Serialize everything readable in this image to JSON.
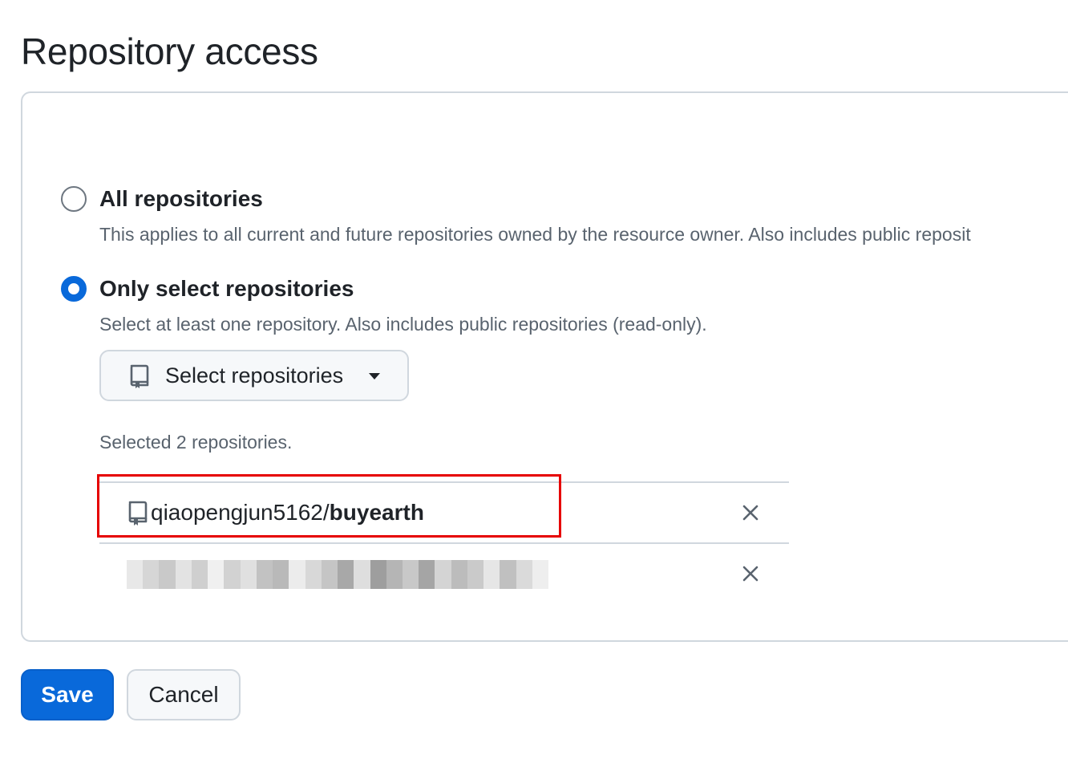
{
  "page": {
    "title": "Repository access"
  },
  "options": {
    "all": {
      "title": "All repositories",
      "description": "This applies to all current and future repositories owned by the resource owner. Also includes public reposit",
      "selected": false
    },
    "select": {
      "title": "Only select repositories",
      "description": "Select at least one repository. Also includes public repositories (read-only).",
      "selected": true
    }
  },
  "repo_picker": {
    "button_label": "Select repositories",
    "icon": "repo-icon"
  },
  "selected_summary": "Selected 2 repositories.",
  "repositories": [
    {
      "owner": "qiaopengjun5162/",
      "name": "buyearth",
      "icon": "repo-icon",
      "remove_icon": "x-icon"
    },
    {
      "owner": "",
      "name": "",
      "redacted": true,
      "remove_icon": "x-icon"
    }
  ],
  "actions": {
    "save_label": "Save",
    "cancel_label": "Cancel"
  },
  "colors": {
    "accent": "#0969da",
    "highlight": "#e60000",
    "border": "#d0d7de",
    "muted_text": "#59636e"
  }
}
